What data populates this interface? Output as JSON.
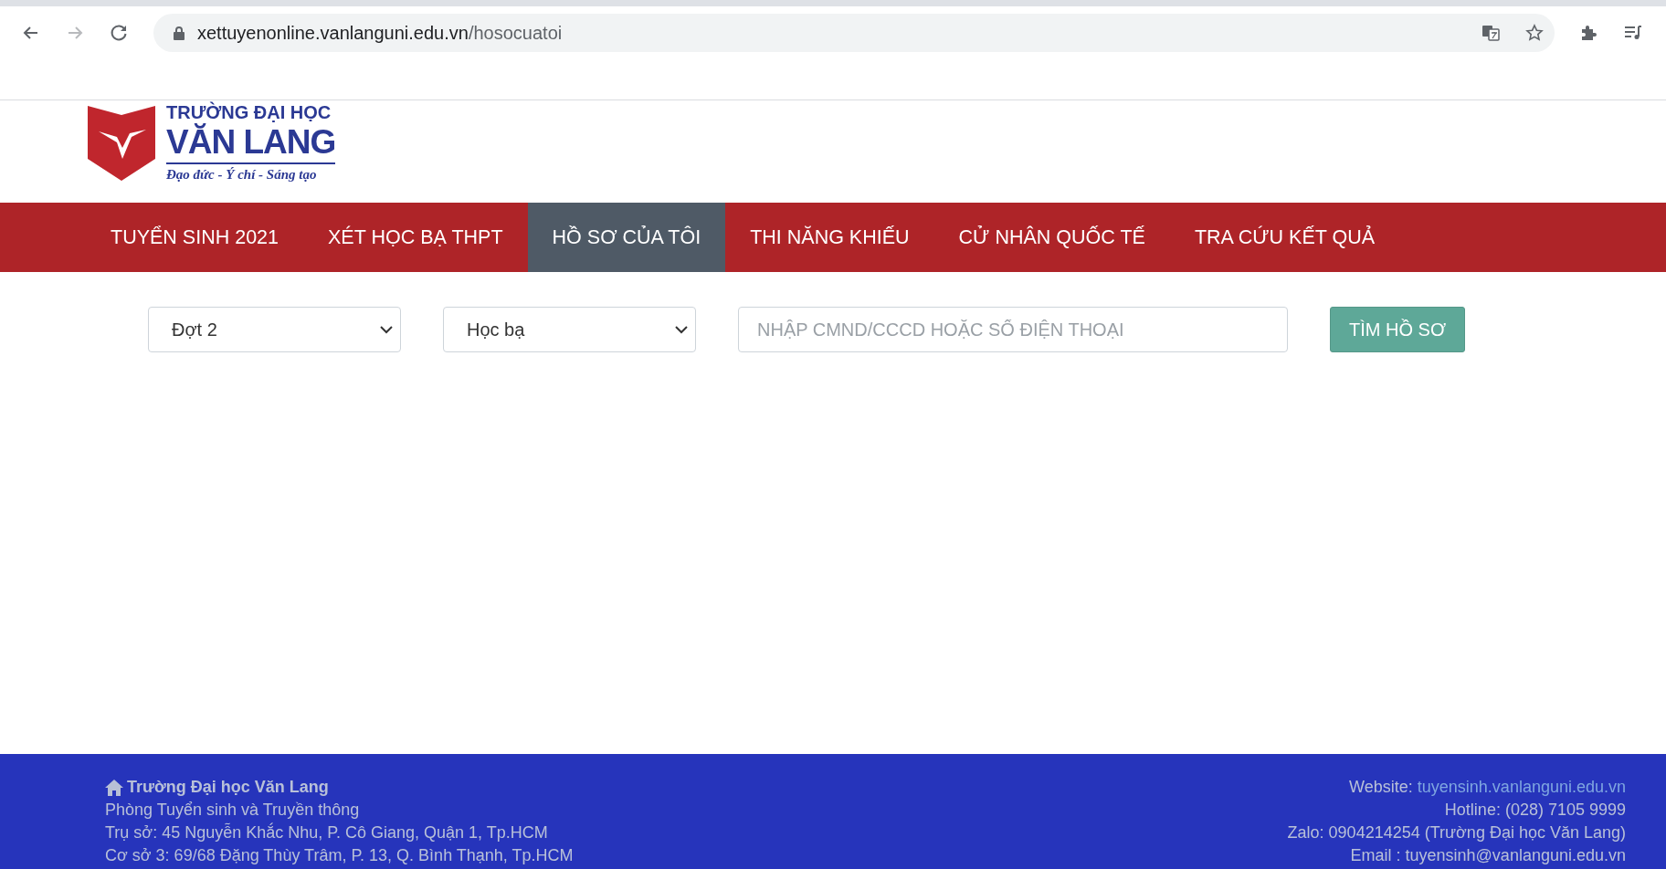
{
  "browser": {
    "nav_buttons": [
      {
        "kind": "back",
        "disabled": false
      },
      {
        "kind": "forward",
        "disabled": true
      },
      {
        "kind": "reload",
        "disabled": false
      }
    ],
    "url_host": "xettuyenonline.vanlanguni.edu.vn",
    "url_path": "/hosocuatoi"
  },
  "logo": {
    "line_1": "TRƯỜNG ĐẠI HỌC",
    "line_2": "VĂN LANG",
    "motto": "Đạo đức - Ý chí - Sáng tạo"
  },
  "nav": [
    {
      "label": "TUYỂN SINH 2021",
      "selected": false
    },
    {
      "label": "XÉT HỌC BẠ THPT",
      "selected": false
    },
    {
      "label": "HỒ SƠ CỦA TÔI",
      "selected": true
    },
    {
      "label": "THI NĂNG KHIẾU",
      "selected": false
    },
    {
      "label": "CỬ NHÂN QUỐC TẾ",
      "selected": false
    },
    {
      "label": "TRA CỨU KẾT QUẢ",
      "selected": false
    }
  ],
  "search": {
    "round_select": "Đợt 2",
    "method_select": "Học bạ",
    "id_field": {
      "placeholder": "NHẬP CMND/CCCD HOẶC SỐ ĐIỆN THOẠI"
    },
    "button": "TÌM HỒ SƠ"
  },
  "footer": {
    "left": {
      "title": "Trường Đại học Văn Lang",
      "lines": [
        "Phòng Tuyển sinh và Truyền thông",
        "Trụ sở: 45 Nguyễn Khắc Nhu, P. Cô Giang, Quận 1, Tp.HCM",
        "Cơ sở 3: 69/68 Đặng Thùy Trâm, P. 13, Q. Bình Thạnh, Tp.HCM"
      ]
    },
    "right": {
      "website_label": "Website:",
      "website_link": "tuyensinh.vanlanguni.edu.vn",
      "lines": [
        "Hotline: (028) 7105 9999",
        "Zalo: 0904214254 (Trường Đại học Văn Lang)",
        "Email : tuyensinh@vanlanguni.edu.vn"
      ]
    }
  }
}
